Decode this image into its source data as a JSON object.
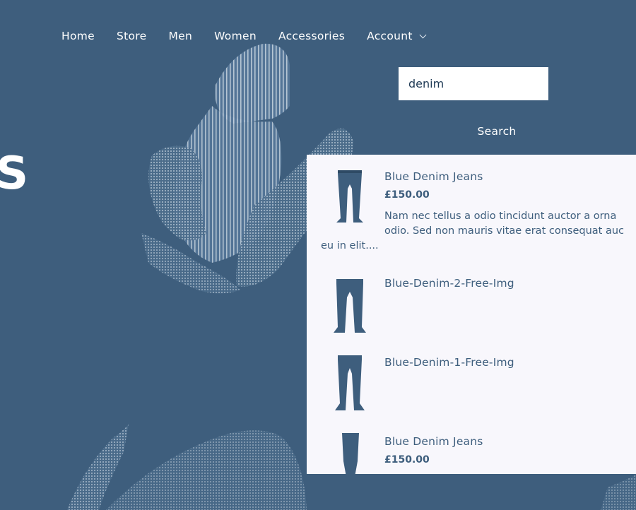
{
  "nav": {
    "items": [
      {
        "label": "Home"
      },
      {
        "label": "Store"
      },
      {
        "label": "Men"
      },
      {
        "label": "Women"
      },
      {
        "label": "Accessories"
      },
      {
        "label": "Account",
        "has_dropdown": true
      }
    ]
  },
  "hero": {
    "heading_fragment": "S"
  },
  "search": {
    "value": "denim",
    "button_label": "Search"
  },
  "results": [
    {
      "title": "Blue Denim Jeans",
      "price": "£150.00",
      "description_lines": [
        "Nam nec tellus a odio tincidunt auctor a orna",
        "odio. Sed non mauris vitae erat consequat auc",
        "eu in elit...."
      ]
    },
    {
      "title": "Blue-Denim-2-Free-Img"
    },
    {
      "title": "Blue-Denim-1-Free-Img"
    },
    {
      "title": "Blue Denim Jeans",
      "price": "£150.00"
    }
  ],
  "colors": {
    "page_background": "#3e5e7d",
    "dropdown_background": "#f8f7fc",
    "accent_text": "#3e5e7d",
    "artwork": "#a9bccd"
  },
  "icons": {
    "account_dropdown": "chevron-down-icon",
    "result_images": "jeans-thumbnail"
  }
}
